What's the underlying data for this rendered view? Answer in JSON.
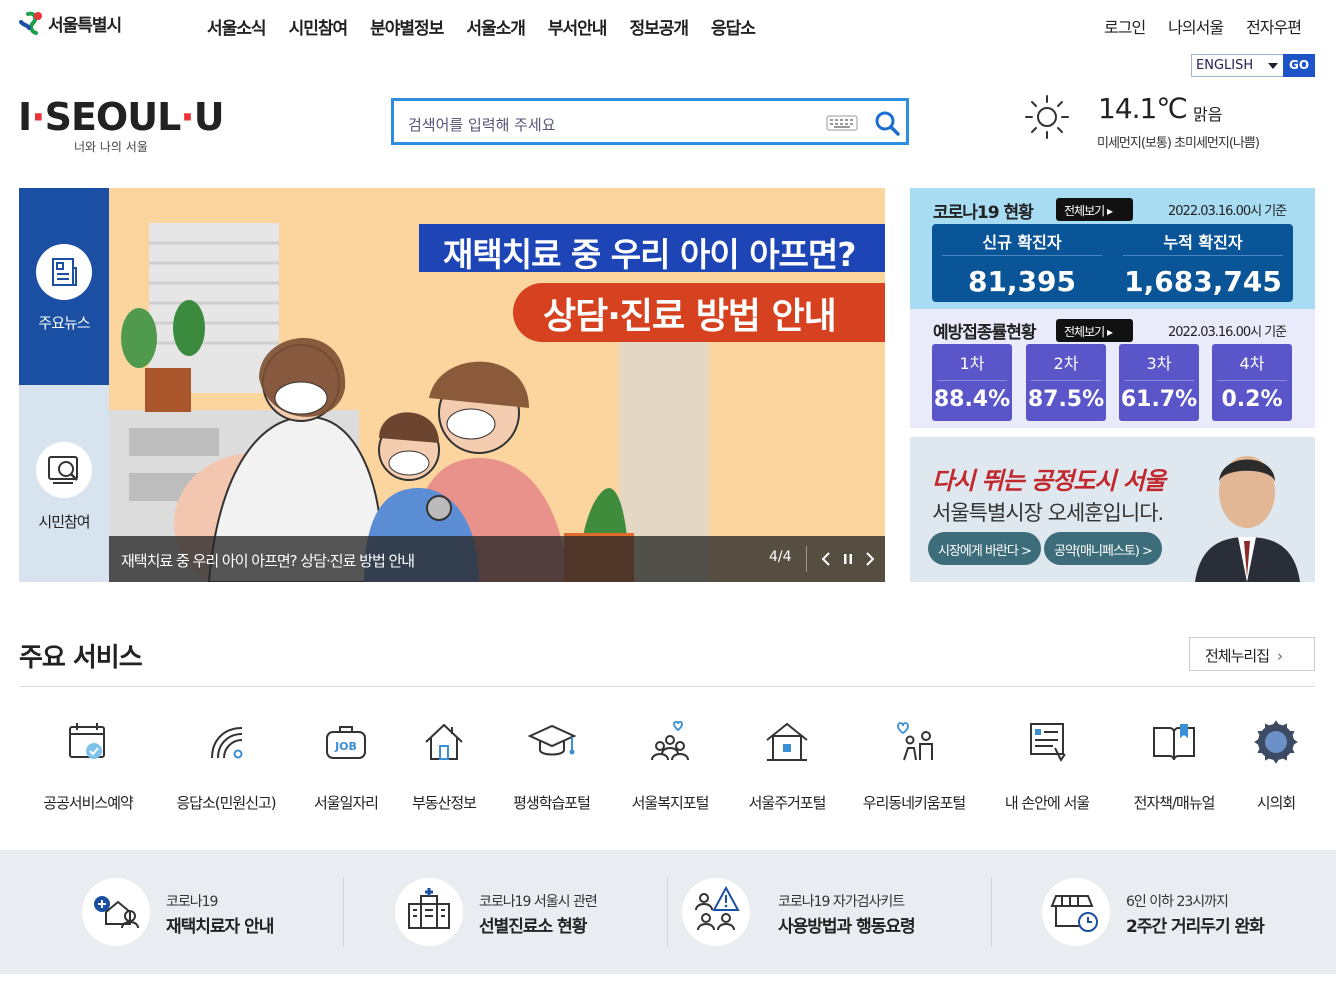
{
  "header": {
    "site_name": "서울특별시",
    "gnb": [
      "서울소식",
      "시민참여",
      "분야별정보",
      "서울소개",
      "부서안내",
      "정보공개",
      "응답소"
    ],
    "util": [
      "로그인",
      "나의서울",
      "전자우편"
    ],
    "lang_value": "ENGLISH",
    "go_label": "GO",
    "brand": "I·SEOUL·U",
    "brand_sub": "너와 나의 서울",
    "search_placeholder": "검색어를 입력해 주세요",
    "weather": {
      "temp": "14.1℃",
      "sky": "맑음",
      "dust": "미세먼지(보통) 초미세먼지(나쁨)"
    }
  },
  "side_tabs": {
    "news": "주요뉴스",
    "participation": "시민참여"
  },
  "banner": {
    "title1": "재택치료 중 우리 아이 아프면?",
    "title2": "상담·진료 방법 안내",
    "caption": "재택치료 중 우리 아이 아프면? 상담·진료 방법 안내",
    "page": "4/4"
  },
  "covid": {
    "title": "코로나19 현황",
    "more": "전체보기",
    "date": "2022.03.16.00시 기준",
    "new_label": "신규 확진자",
    "new_value": "81,395",
    "total_label": "누적 확진자",
    "total_value": "1,683,745"
  },
  "vaccine": {
    "title": "예방접종률현황",
    "more": "전체보기",
    "date": "2022.03.16.00시 기준",
    "doses": [
      {
        "label": "1차",
        "value": "88.4%"
      },
      {
        "label": "2차",
        "value": "87.5%"
      },
      {
        "label": "3차",
        "value": "61.7%"
      },
      {
        "label": "4차",
        "value": "0.2%"
      }
    ]
  },
  "mayor": {
    "slogan": "다시 뛰는 공정도시 서울",
    "name": "서울특별시장 오세훈입니다.",
    "btn1": "시장에게 바란다 >",
    "btn2": "공약(매니페스토) >"
  },
  "services": {
    "title": "주요 서비스",
    "more": "전체누리집",
    "items": [
      "공공서비스예약",
      "응답소(민원신고)",
      "서울일자리",
      "부동산정보",
      "평생학습포털",
      "서울복지포털",
      "서울주거포털",
      "우리동네키움포털",
      "내 손안에 서울",
      "전자책/매뉴얼",
      "시의회"
    ]
  },
  "band": [
    {
      "t1": "코로나19",
      "t2": "재택치료자 안내"
    },
    {
      "t1": "코로나19 서울시 관련",
      "t2": "선별진료소 현황"
    },
    {
      "t1": "코로나19 자가검사키트",
      "t2": "사용방법과 행동요령"
    },
    {
      "t1": "6인 이하 23시까지",
      "t2": "2주간 거리두기 완화"
    }
  ],
  "colors": {
    "primary": "#1a4fa4",
    "covid_bg": "#a8dcf2",
    "covid_box": "#0a5498",
    "vacc_box": "#5a55c8",
    "search_border": "#2e8ee0"
  }
}
